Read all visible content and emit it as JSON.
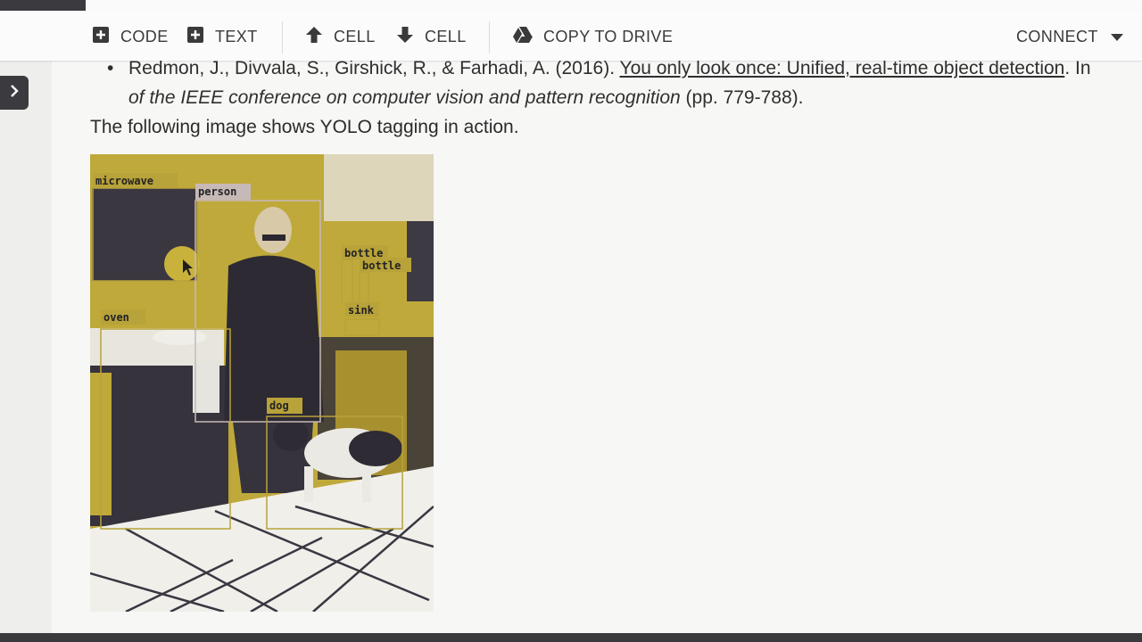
{
  "toolbar": {
    "code_label": "CODE",
    "text_label": "TEXT",
    "cell_up_label": "CELL",
    "cell_down_label": "CELL",
    "copy_drive_label": "COPY TO DRIVE",
    "connect_label": "CONNECT",
    "icons": [
      "plus-box-icon",
      "plus-box-icon",
      "arrow-up-icon",
      "arrow-down-icon",
      "drive-icon",
      "caret-down-icon"
    ]
  },
  "notebook": {
    "reference": {
      "authors": "Redmon, J., Divvala, S., Girshick, R., & Farhadi, A. (2016). ",
      "link_title": "You only look once: Unified, real-time object detection",
      "after_link": ". In",
      "venue": "of the IEEE conference on computer vision and pattern recognition",
      "pages": " (pp. 779-788)."
    },
    "caption": "The following image shows YOLO tagging in action.",
    "detections": [
      "microwave",
      "person",
      "bottle",
      "bottle",
      "sink",
      "oven",
      "dog"
    ]
  },
  "colors": {
    "toolbar_bg": "#fbfbfb",
    "olive": "#b9a437",
    "dark_ui": "#3b3b3f"
  }
}
